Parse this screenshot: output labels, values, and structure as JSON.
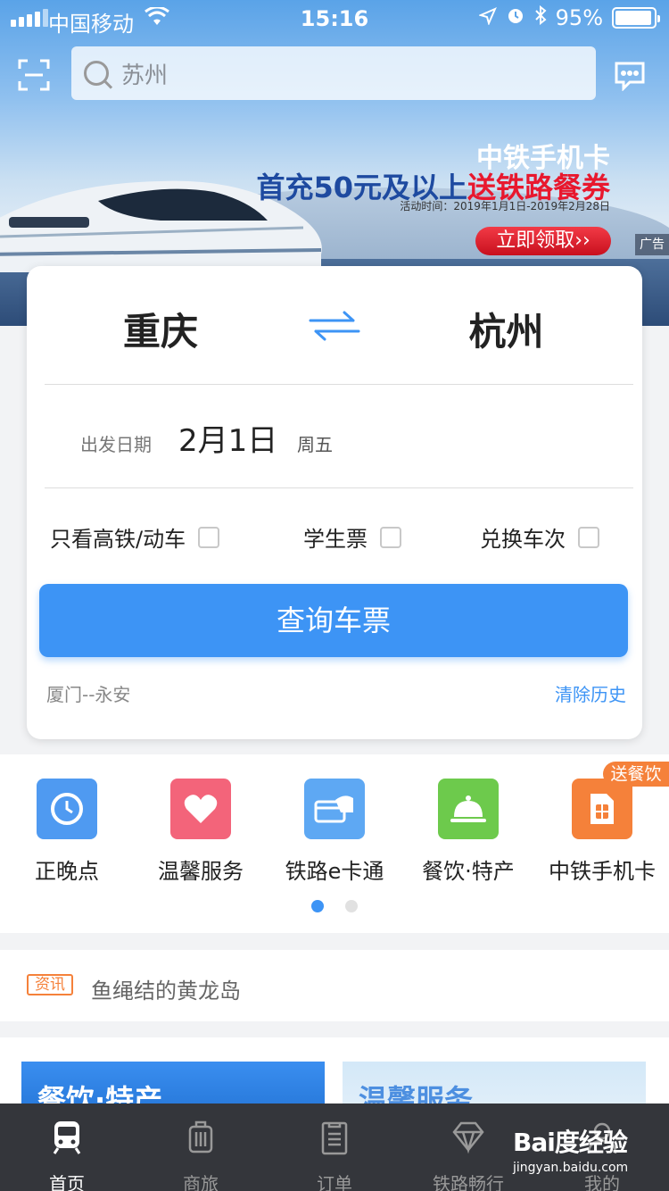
{
  "status_bar": {
    "carrier": "中国移动",
    "time": "15:16",
    "battery": "95%",
    "battery_level": 0.95
  },
  "search": {
    "placeholder": "苏州"
  },
  "banner": {
    "line1": "中铁手机卡",
    "line2_prefix": "首充50元及以上",
    "line2_highlight": "送铁路餐券",
    "period": "活动时间：2019年1月1日-2019年2月28日",
    "cta": "立即领取",
    "cta_arrows": "››",
    "ad_tag": "广告",
    "colors": {
      "highlight": "#e8182e",
      "primary_text": "#1e4aa0"
    }
  },
  "booking": {
    "from": "重庆",
    "to": "杭州",
    "date_label": "出发日期",
    "date": "2月1日",
    "weekday": "周五",
    "options": [
      {
        "label": "只看高铁/动车",
        "checked": false
      },
      {
        "label": "学生票",
        "checked": false
      },
      {
        "label": "兑换车次",
        "checked": false
      }
    ],
    "query_button": "查询车票",
    "history_item": "厦门--永安",
    "clear_history": "清除历史",
    "accent": "#3d94f5"
  },
  "services": {
    "items": [
      {
        "label": "正晚点",
        "icon": "clock-icon",
        "color": "#4f9af1"
      },
      {
        "label": "温馨服务",
        "icon": "heart-icon",
        "color": "#f3647a"
      },
      {
        "label": "铁路e卡通",
        "icon": "card-icon",
        "color": "#5ea8f3"
      },
      {
        "label": "餐饮·特产",
        "icon": "service-bell-icon",
        "color": "#6dca4c"
      },
      {
        "label": "中铁手机卡",
        "icon": "sim-card-icon",
        "color": "#f5813a"
      }
    ],
    "badge": "送餐饮",
    "page": 1,
    "pages": 2
  },
  "news": {
    "tag": "资讯",
    "text": "鱼绳结的黄龙岛"
  },
  "promos": [
    {
      "title": "餐饮·特产",
      "color": "#1f6fd0"
    },
    {
      "title": "温馨服务",
      "color": "#4d8fe0"
    }
  ],
  "tabbar": {
    "tabs": [
      {
        "label": "首页",
        "icon": "train-icon",
        "active": true
      },
      {
        "label": "商旅",
        "icon": "luggage-icon",
        "active": false
      },
      {
        "label": "订单",
        "icon": "clipboard-icon",
        "active": false
      },
      {
        "label": "铁路畅行",
        "icon": "diamond-icon",
        "active": false
      },
      {
        "label": "我的",
        "icon": "person-icon",
        "active": false
      }
    ]
  },
  "watermark": {
    "logo": "Bai度经验",
    "url": "jingyan.baidu.com"
  }
}
